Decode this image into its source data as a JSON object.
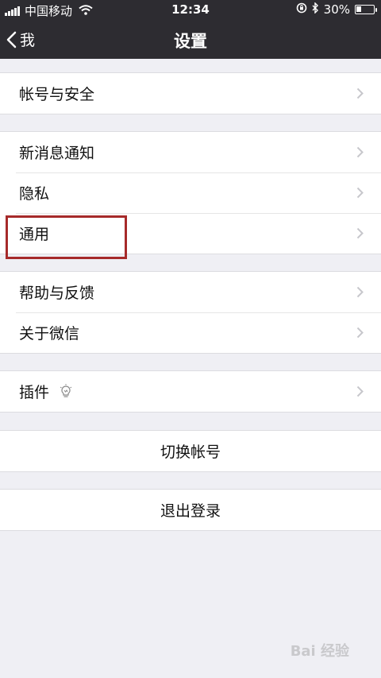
{
  "status_bar": {
    "carrier": "中国移动",
    "time": "12:34",
    "battery": "30%",
    "battery_level": 0.3
  },
  "nav": {
    "back_label": "我",
    "title": "设置"
  },
  "groups": [
    {
      "items": [
        {
          "label": "帐号与安全"
        }
      ]
    },
    {
      "items": [
        {
          "label": "新消息通知"
        },
        {
          "label": "隐私"
        },
        {
          "label": "通用"
        }
      ]
    },
    {
      "items": [
        {
          "label": "帮助与反馈"
        },
        {
          "label": "关于微信"
        }
      ]
    },
    {
      "items": [
        {
          "label": "插件"
        }
      ]
    }
  ],
  "actions": {
    "switch_account": "切换帐号",
    "logout": "退出登录"
  },
  "watermark": "Bai 经验",
  "colors": {
    "navbar": "#2d2c31",
    "background": "#efeff4",
    "highlight": "#a62a2a"
  }
}
